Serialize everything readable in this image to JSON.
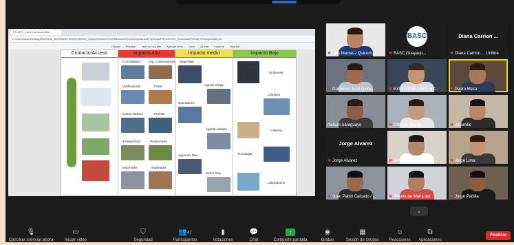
{
  "share": {
    "tab_title": "PR-MPL_Lista Contactos Mar...",
    "url": "C:/Users/ibrar/Desktop/Escritorio_BERNARDO/Reflex/Reflex_/apoyo/MODULO%20Modulo/Ejecucion/Modulo/Empresas/PROCESOS_Conductas%20de%20seguridad.pdf",
    "pdf_tools": [
      "Dibujar",
      "Resaltar",
      "Leer en voz alta",
      "Agregar texto",
      "Girar",
      "Ajustar",
      "Imprimir",
      "Guardar"
    ],
    "columns": [
      {
        "title": "Contacto/Acceso",
        "color": "#ffffff"
      },
      {
        "title": "Impacto Alto",
        "color": "#e53935"
      },
      {
        "title": "Impacto medio",
        "color": "#f2e24a"
      },
      {
        "title": "Impacto Bajo",
        "color": "#8cc850"
      }
    ],
    "labels_alto": [
      "Consolidador",
      "Imp. Contenedores",
      "Verificadoras",
      "Patios",
      "Lineas Naviera",
      "Puertos",
      "Transportista",
      "Productores",
      "Exportador",
      "Importador"
    ],
    "labels_medio": [
      "Seguridad",
      "Agente Carga",
      "Operadores",
      "Agente Aduana",
      "Agencias Nav.",
      "Sellos Seg."
    ],
    "labels_bajo": [
      "Uniformes",
      "Limpieza",
      "Catering",
      "Tecnologia",
      "Laboratorios"
    ]
  },
  "participants": [
    {
      "name": "Luis Macias / Quicorn...",
      "type": "video"
    },
    {
      "name": "BASC Guayaqu...",
      "type": "logo",
      "logo": "BASC"
    },
    {
      "name": "Diana Carrion ... Uniline",
      "type": "text",
      "big": "Diana Carrion ..."
    },
    {
      "name": "Guillermo José Quinc...",
      "type": "video"
    },
    {
      "name": "EXPOTUNA-LADY BC...",
      "type": "video"
    },
    {
      "name": "Pedro Meza",
      "type": "video",
      "active": true
    },
    {
      "name": "Nelson Saraguayo",
      "type": "video"
    },
    {
      "name": "Orlando Bueno",
      "type": "video"
    },
    {
      "name": "Jaramillo",
      "type": "video"
    },
    {
      "name": "Jorge Alvarez",
      "type": "text",
      "big": "Jorge Alvarez"
    },
    {
      "name": "Jenny Andrade / SAC...",
      "type": "video"
    },
    {
      "name": "Jorge Lima",
      "type": "video"
    },
    {
      "name": "Juan Pablo Caicedo / ...",
      "type": "video"
    },
    {
      "name": "iPhone de Maria del ...",
      "type": "video"
    },
    {
      "name": "Jorge Padilla",
      "type": "video"
    }
  ],
  "toolbar": {
    "mute_label": "Cancelar silenciar ahora",
    "video_label": "Iniciar video",
    "security_label": "Seguridad",
    "participants_label": "Participantes",
    "participants_count": "47",
    "polls_label": "Votaciones",
    "chat_label": "Chat",
    "share_label": "Compartir pantalla",
    "record_label": "Grabar",
    "rooms_label": "Sesión de Grupos",
    "reactions_label": "Reacciones",
    "apps_label": "Aplicaciones",
    "end_label": "Finalizar"
  },
  "colors": {
    "share_green": "#22a745",
    "end_red": "#e02828",
    "active_speaker": "#ffd400"
  }
}
